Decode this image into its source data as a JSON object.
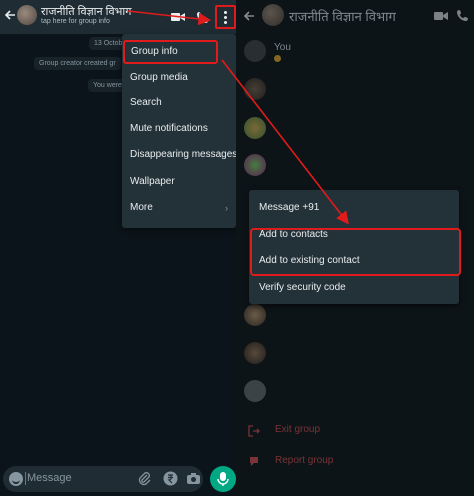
{
  "chat": {
    "group_name": "राजनीति विज्ञान विभाग",
    "subtitle": "tap here for group info",
    "date_chip": "13 Octob",
    "system_chip_1": "Group creator created gr",
    "system_chip_2": "You were",
    "input_placeholder": "Message"
  },
  "menu": {
    "items": [
      {
        "label": "Group info"
      },
      {
        "label": "Group media"
      },
      {
        "label": "Search"
      },
      {
        "label": "Mute notifications"
      },
      {
        "label": "Disappearing messages"
      },
      {
        "label": "Wallpaper"
      },
      {
        "label": "More",
        "chevron": "›"
      }
    ]
  },
  "info": {
    "group_name": "राजनीति विज्ञान विभाग",
    "you_label": "You",
    "exit_label": "Exit group",
    "report_label": "Report group"
  },
  "context_menu": {
    "items": [
      {
        "label": "Message +91"
      },
      {
        "label": "Add to contacts"
      },
      {
        "label": "Add to existing contact"
      },
      {
        "label": "Verify security code"
      }
    ]
  },
  "colors": {
    "annotation_red": "#e01b1b",
    "accent_green": "#00a884",
    "panel_bg": "#233138",
    "header_bg": "#1f2c33"
  },
  "icons": [
    "back-arrow-icon",
    "video-call-icon",
    "phone-icon",
    "more-vert-icon",
    "emoji-icon",
    "attach-icon",
    "rupee-icon",
    "camera-icon",
    "mic-icon",
    "exit-icon",
    "report-icon"
  ]
}
